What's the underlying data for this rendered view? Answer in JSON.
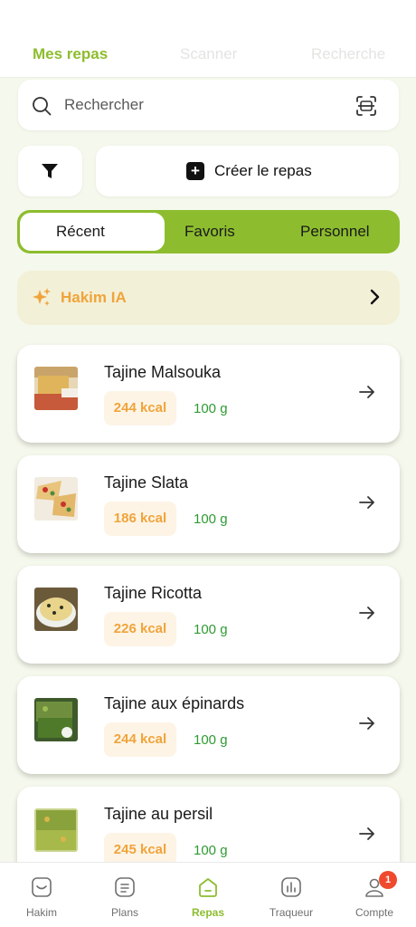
{
  "top_tabs": [
    {
      "label": "Mes repas",
      "active": true
    },
    {
      "label": "Scanner",
      "active": false
    },
    {
      "label": "Recherche",
      "active": false
    }
  ],
  "search": {
    "placeholder": "Rechercher",
    "icon": "search-icon",
    "scan_icon": "scan-icon"
  },
  "actions": {
    "filter_icon": "filter-icon",
    "create_label": "Créer le repas",
    "create_icon": "plus-icon"
  },
  "segments": [
    {
      "label": "Récent",
      "active": true
    },
    {
      "label": "Favoris",
      "active": false
    },
    {
      "label": "Personnel",
      "active": false
    }
  ],
  "ai_banner": {
    "label": "Hakim IA",
    "icon": "sparkle-icon"
  },
  "meals": [
    {
      "name": "Tajine Malsouka",
      "kcal": "244 kcal",
      "weight": "100 g"
    },
    {
      "name": "Tajine Slata",
      "kcal": "186 kcal",
      "weight": "100 g"
    },
    {
      "name": "Tajine Ricotta",
      "kcal": "226 kcal",
      "weight": "100 g"
    },
    {
      "name": "Tajine aux épinards",
      "kcal": "244 kcal",
      "weight": "100 g"
    },
    {
      "name": "Tajine au persil",
      "kcal": "245 kcal",
      "weight": "100 g"
    }
  ],
  "bottom_nav": [
    {
      "label": "Hakim",
      "icon": "hakim-icon",
      "active": false
    },
    {
      "label": "Plans",
      "icon": "plans-icon",
      "active": false
    },
    {
      "label": "Repas",
      "icon": "repas-icon",
      "active": true
    },
    {
      "label": "Traqueur",
      "icon": "tracker-icon",
      "active": false
    },
    {
      "label": "Compte",
      "icon": "account-icon",
      "active": false,
      "badge": "1"
    }
  ],
  "colors": {
    "accent": "#8dbd2e",
    "kcal": "#f0a43a",
    "weight": "#2e9b33",
    "badge": "#ef4a2e"
  }
}
